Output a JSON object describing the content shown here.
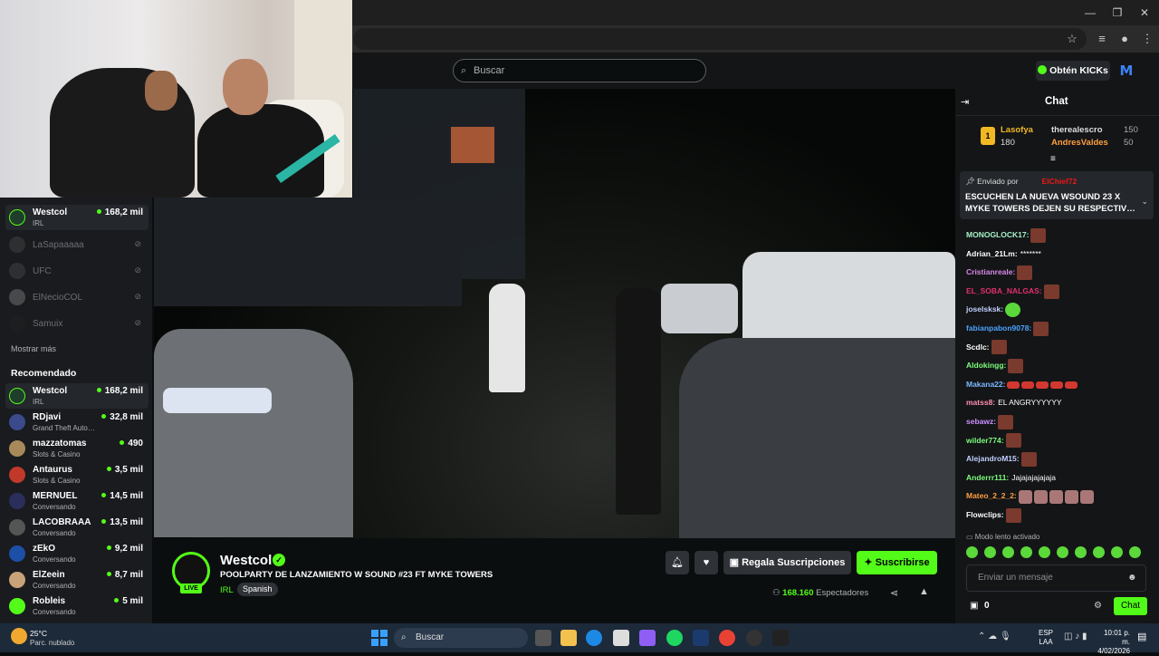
{
  "browser": {
    "window_controls": [
      "—",
      "❐",
      "✕"
    ]
  },
  "nav": {
    "search_placeholder": "Buscar",
    "kicks_button": "Obtén KICKs",
    "avatar_letter": "M"
  },
  "sidebar": {
    "following": [
      {
        "name": "Westcol",
        "category": "IRL",
        "viewers": "168,2 mil",
        "live": true
      },
      {
        "name": "LaSapaaaaa",
        "live": false
      },
      {
        "name": "UFC",
        "live": false
      },
      {
        "name": "ElNecioCOL",
        "live": false
      },
      {
        "name": "Samuix",
        "live": false
      }
    ],
    "show_more": "Mostrar más",
    "recommended_heading": "Recomendado",
    "recommended": [
      {
        "name": "Westcol",
        "category": "IRL",
        "viewers": "168,2 mil"
      },
      {
        "name": "RDjavi",
        "category": "Grand Theft Auto…",
        "viewers": "32,8 mil"
      },
      {
        "name": "mazzatomas",
        "category": "Slots & Casino",
        "viewers": "490"
      },
      {
        "name": "Antaurus",
        "category": "Slots & Casino",
        "viewers": "3,5 mil"
      },
      {
        "name": "MERNUEL",
        "category": "Conversando",
        "viewers": "14,5 mil"
      },
      {
        "name": "LACOBRAAA",
        "category": "Conversando",
        "viewers": "13,5 mil"
      },
      {
        "name": "zEkO",
        "category": "Conversando",
        "viewers": "9,2 mil"
      },
      {
        "name": "ElZeein",
        "category": "Conversando",
        "viewers": "8,7 mil"
      },
      {
        "name": "Robleis",
        "category": "Conversando",
        "viewers": "5 mil"
      }
    ]
  },
  "stream": {
    "streamer": "Westcol",
    "live_badge": "LIVE",
    "title": "POOLPARTY DE LANZAMIENTO W SOUND #23 FT MYKE TOWERS",
    "category": "IRL",
    "language": "Spanish",
    "gift_button": "Regala Suscripciones",
    "subscribe_button": "Suscribirse",
    "viewer_count": "168.160",
    "viewer_label": "Espectadores"
  },
  "chat": {
    "title": "Chat",
    "leaderboard": {
      "first": {
        "rank": "1",
        "name": "Lasofya",
        "value": "180"
      },
      "second": {
        "name": "therealescro",
        "value": "150"
      },
      "third": {
        "name": "AndresValdes",
        "value": "50"
      }
    },
    "pinned": {
      "label": "Enviado por",
      "user": "ElChief72",
      "text": "ESCUCHEN LA NUEVA WSOUND 23 X MYKE TOWERS DEJEN SU RESPECTIV…"
    },
    "messages": [
      {
        "user": "MONOGLOCK17:",
        "color": "#a6f2c9",
        "text": "",
        "emotes": 1
      },
      {
        "user": "Adrian_21Lm:",
        "color": "#ffffff",
        "text": "*******",
        "emotes": 0
      },
      {
        "user": "Cristianreale:",
        "color": "#d58ae6",
        "text": "",
        "emotes": 1
      },
      {
        "user": "EL_SOBA_NALGAS:",
        "color": "#e0306a",
        "text": "",
        "emotes": 1
      },
      {
        "user": "joselsksk:",
        "color": "#c0d0ff",
        "text": "",
        "emotes": 1,
        "green": true
      },
      {
        "user": "fabianpabon9078:",
        "color": "#4aa3ff",
        "text": "",
        "emotes": 1
      },
      {
        "user": "Scdlc:",
        "color": "#ffffff",
        "text": "",
        "emotes": 1
      },
      {
        "user": "Aldokingg:",
        "color": "#7cfc7c",
        "text": "",
        "emotes": 1
      },
      {
        "user": "Makana22:",
        "color": "#7ab8ff",
        "text": "",
        "emotes": 5,
        "small": true
      },
      {
        "user": "matss8:",
        "color": "#ff8fb0",
        "text": "EL ANGRYYYYYY",
        "emotes": 0
      },
      {
        "user": "sebawz:",
        "color": "#c990ff",
        "text": "",
        "emotes": 1
      },
      {
        "user": "wilder774:",
        "color": "#7cfc7c",
        "text": "",
        "emotes": 1
      },
      {
        "user": "AlejandroM15:",
        "color": "#c0d0ff",
        "text": "",
        "emotes": 1
      },
      {
        "user": "Anderrr111:",
        "color": "#7cfc7c",
        "text": "Jajajajajajaja",
        "emotes": 0
      },
      {
        "user": "Mateo_2_2_2:",
        "color": "#ff9f43",
        "text": "",
        "emotes": 5,
        "face": true
      },
      {
        "user": "Flowclips:",
        "color": "#ffffff",
        "text": "",
        "emotes": 1
      }
    ],
    "slow_mode": "Modo lento activado",
    "input_placeholder": "Enviar un mensaje",
    "gift_count": "0",
    "send_button": "Chat"
  },
  "taskbar": {
    "temperature": "25°C",
    "weather": "Parc. nublado",
    "search": "Buscar",
    "lang_top": "ESP",
    "lang_bottom": "LAA",
    "time": "10:01 p. m.",
    "date": "4/02/2026"
  },
  "colors": {
    "accent": "#53fc18",
    "background": "#0b0e0f",
    "panel": "#191b1f"
  }
}
